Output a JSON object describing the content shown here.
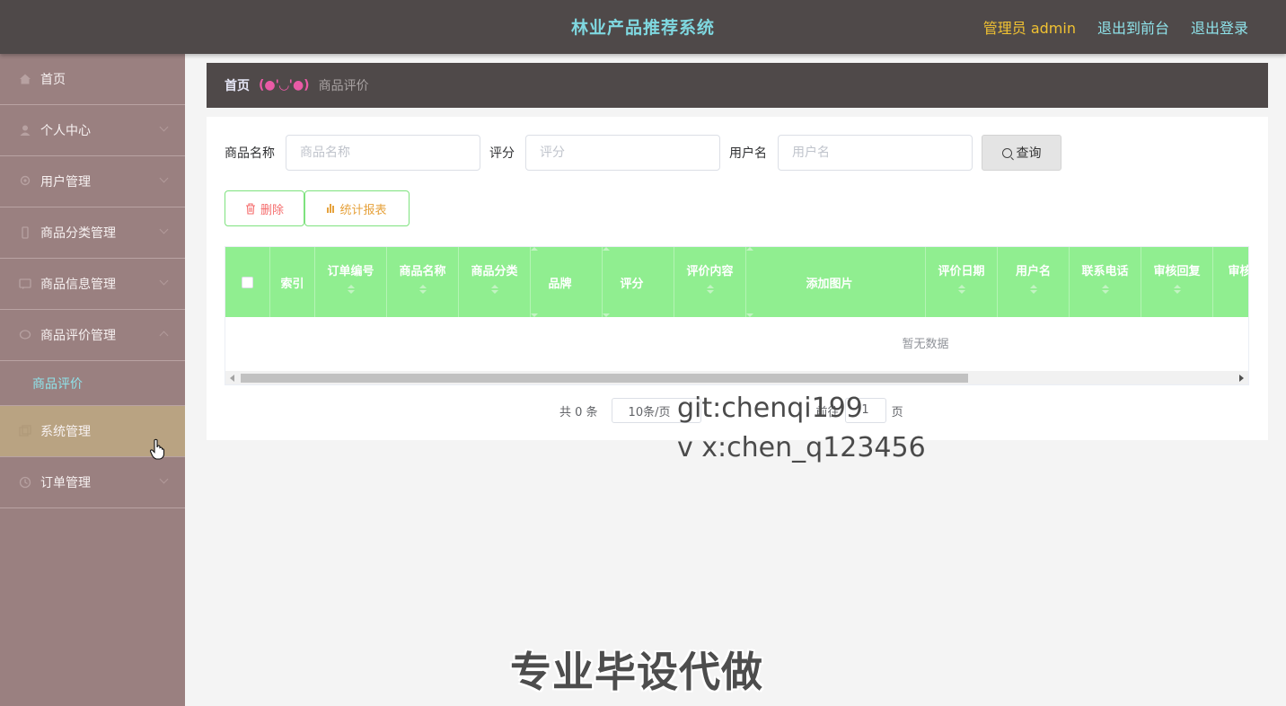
{
  "header": {
    "title": "林业产品推荐系统",
    "user_label": "管理员 admin",
    "to_front_label": "退出到前台",
    "logout_label": "退出登录"
  },
  "sidebar": {
    "items": [
      {
        "label": "首页",
        "icon": "home-icon"
      },
      {
        "label": "个人中心",
        "icon": "user-icon"
      },
      {
        "label": "用户管理",
        "icon": "users-icon"
      },
      {
        "label": "商品分类管理",
        "icon": "category-icon"
      },
      {
        "label": "商品信息管理",
        "icon": "product-icon"
      },
      {
        "label": "商品评价管理",
        "icon": "comment-icon",
        "expanded": true
      },
      {
        "label": "系统管理",
        "icon": "system-icon"
      },
      {
        "label": "订单管理",
        "icon": "order-icon"
      }
    ],
    "submenu": {
      "label": "商品评价"
    }
  },
  "breadcrumb": {
    "home": "首页",
    "emoticon": "(●'◡'●)",
    "current": "商品评价"
  },
  "search": {
    "product_name_label": "商品名称",
    "product_name_placeholder": "商品名称",
    "rating_label": "评分",
    "rating_placeholder": "评分",
    "username_label": "用户名",
    "username_placeholder": "用户名",
    "query_label": "查询"
  },
  "actions": {
    "delete_label": "删除",
    "report_label": "统计报表"
  },
  "table": {
    "columns": [
      "索引",
      "订单编号",
      "商品名称",
      "商品分类",
      "品牌",
      "评分",
      "评价内容",
      "添加图片",
      "评价日期",
      "用户名",
      "联系电话",
      "审核回复",
      "审核"
    ],
    "empty_text": "暂无数据"
  },
  "pagination": {
    "total_label": "共 0 条",
    "page_size": "10条/页",
    "goto_label": "前往",
    "page": "1",
    "page_suffix": "页"
  },
  "overlay": {
    "line1": "git:chenqi199",
    "line2": "v x:chen_q123456",
    "banner": "专业毕设代做"
  },
  "colors": {
    "header_bg": "#4f4949",
    "sidebar_bg": "#9a8080",
    "table_header": "#90ee90",
    "title": "#7fd8e0",
    "user": "#f1c232"
  }
}
